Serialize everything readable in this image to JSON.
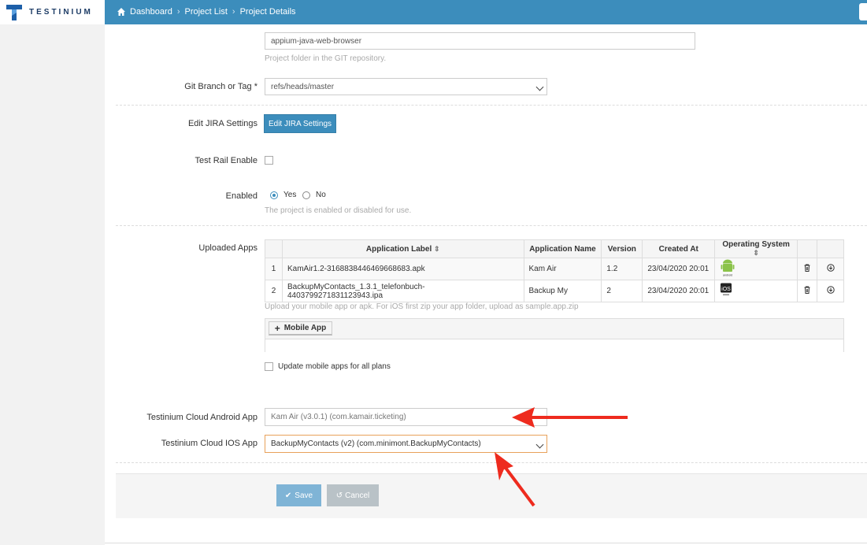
{
  "brand": {
    "name": "TESTINIUM",
    "logo_color": "#1d3c66",
    "accent": "#3c8dbc"
  },
  "breadcrumb": [
    "Dashboard",
    "Project List",
    "Project Details"
  ],
  "form": {
    "project_path": {
      "value": "appium-java-web-browser",
      "help": "Project folder in the GIT repository."
    },
    "git_branch": {
      "label": "Git Branch or Tag *",
      "value": "refs/heads/master"
    },
    "jira": {
      "label": "Edit JIRA Settings",
      "button": "Edit JIRA Settings"
    },
    "test_rail": {
      "label": "Test Rail Enable",
      "checked": false
    },
    "enabled": {
      "label": "Enabled",
      "yes": "Yes",
      "no": "No",
      "selected": "Yes",
      "help": "The project is enabled or disabled for use."
    },
    "uploaded_apps": {
      "label": "Uploaded Apps",
      "columns": [
        "Application Label",
        "Application Name",
        "Version",
        "Created At",
        "Operating System"
      ],
      "rows": [
        {
          "index": "1",
          "label": "KamAir1.2-3168838446469668683.apk",
          "name": "Kam Air",
          "version": "1.2",
          "created": "23/04/2020 20:01",
          "os": "android",
          "os_text": "android"
        },
        {
          "index": "2",
          "label": "BackupMyContacts_1.3.1_telefonbuch-4403799271831123943.ipa",
          "name": "Backup My",
          "version": "2",
          "created": "23/04/2020 20:01",
          "os": "ios",
          "os_text": "iOS"
        }
      ],
      "help": "Upload your mobile app or apk. For iOS first zip your app folder, upload as sample.app.zip",
      "add_button": "Mobile App",
      "update_all": "Update mobile apps for all plans"
    },
    "android_app": {
      "label": "Testinium Cloud Android App",
      "value": "Kam Air (v3.0.1) (com.kamair.ticketing)"
    },
    "ios_app": {
      "label": "Testinium Cloud IOS App",
      "value": "BackupMyContacts (v2) (com.minimont.BackupMyContacts)"
    }
  },
  "actions": {
    "save": "Save",
    "cancel": "Cancel"
  },
  "annotations": {
    "arrow_color": "#ee2b1e"
  }
}
